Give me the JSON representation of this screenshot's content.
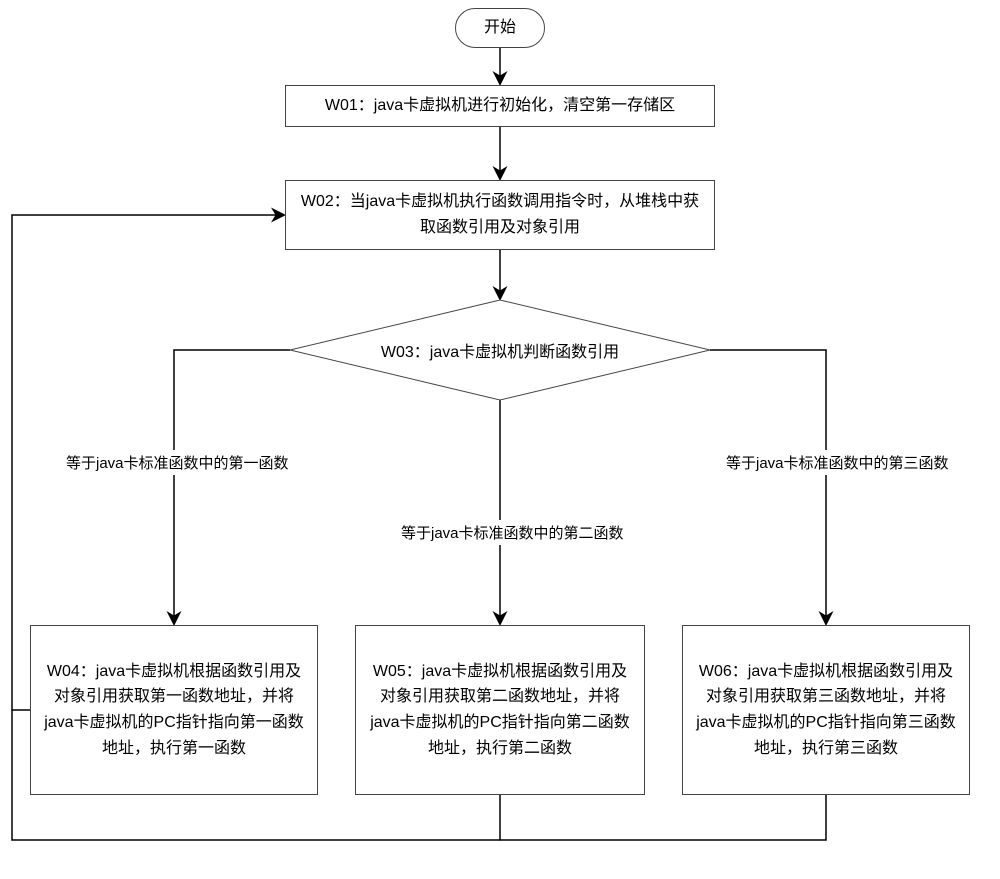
{
  "chart_data": {
    "type": "flowchart",
    "title": "",
    "nodes": [
      {
        "id": "start",
        "type": "terminator",
        "text": "开始"
      },
      {
        "id": "w01",
        "type": "process",
        "text": "W01：java卡虚拟机进行初始化，清空第一存储区"
      },
      {
        "id": "w02",
        "type": "process",
        "text": "W02：当java卡虚拟机执行函数调用指令时，从堆栈中获取函数引用及对象引用"
      },
      {
        "id": "w03",
        "type": "decision",
        "text": "W03：java卡虚拟机判断函数引用"
      },
      {
        "id": "w04",
        "type": "process",
        "text": "W04：java卡虚拟机根据函数引用及对象引用获取第一函数地址，并将java卡虚拟机的PC指针指向第一函数地址，执行第一函数"
      },
      {
        "id": "w05",
        "type": "process",
        "text": "W05：java卡虚拟机根据函数引用及对象引用获取第二函数地址，并将java卡虚拟机的PC指针指向第二函数地址，执行第二函数"
      },
      {
        "id": "w06",
        "type": "process",
        "text": "W06：java卡虚拟机根据函数引用及对象引用获取第三函数地址，并将java卡虚拟机的PC指针指向第三函数地址，执行第三函数"
      }
    ],
    "edges": [
      {
        "from": "start",
        "to": "w01",
        "label": ""
      },
      {
        "from": "w01",
        "to": "w02",
        "label": ""
      },
      {
        "from": "w02",
        "to": "w03",
        "label": ""
      },
      {
        "from": "w03",
        "to": "w04",
        "label": "等于java卡标准函数中的第一函数"
      },
      {
        "from": "w03",
        "to": "w05",
        "label": "等于java卡标准函数中的第二函数"
      },
      {
        "from": "w03",
        "to": "w06",
        "label": "等于java卡标准函数中的第三函数"
      },
      {
        "from": "w04",
        "to": "w02",
        "label": ""
      },
      {
        "from": "w05",
        "to": "w02",
        "label": ""
      },
      {
        "from": "w06",
        "to": "w02",
        "label": ""
      }
    ]
  },
  "labels": {
    "start": "开始",
    "w01": "W01：java卡虚拟机进行初始化，清空第一存储区",
    "w02": "W02：当java卡虚拟机执行函数调用指令时，从堆栈中获取函数引用及对象引用",
    "w03": "W03：java卡虚拟机判断函数引用",
    "w04": "W04：java卡虚拟机根据函数引用及对象引用获取第一函数地址，并将java卡虚拟机的PC指针指向第一函数地址，执行第一函数",
    "w05": "W05：java卡虚拟机根据函数引用及对象引用获取第二函数地址，并将java卡虚拟机的PC指针指向第二函数地址，执行第二函数",
    "w06": "W06：java卡虚拟机根据函数引用及对象引用获取第三函数地址，并将java卡虚拟机的PC指针指向第三函数地址，执行第三函数",
    "branch_left": "等于java卡标准函数中的第一函数",
    "branch_mid": "等于java卡标准函数中的第二函数",
    "branch_right": "等于java卡标准函数中的第三函数"
  }
}
